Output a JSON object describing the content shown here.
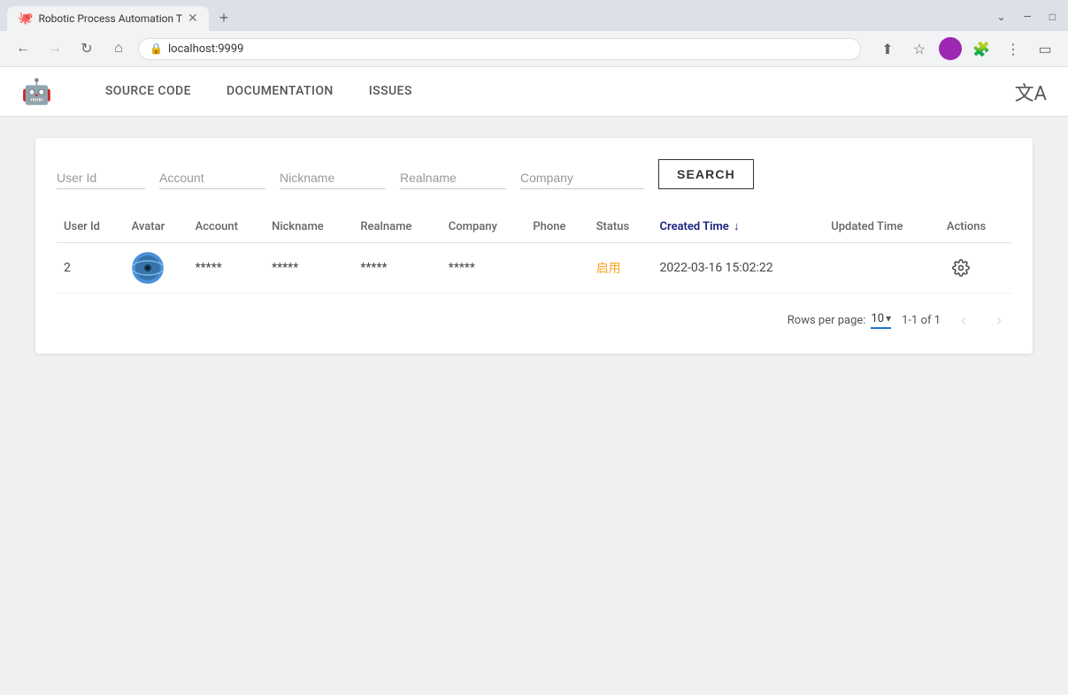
{
  "browser": {
    "tab_title": "Robotic Process Automation T",
    "tab_favicon": "🐙",
    "url": "localhost:9999",
    "new_tab_label": "+",
    "nav_back": "←",
    "nav_forward": "→",
    "nav_refresh": "↻",
    "nav_home": "⌂",
    "window_minimize": "—",
    "window_maximize": "□",
    "window_close": "✕"
  },
  "app": {
    "title": "Robotic Process Automation",
    "logo_icon": "🤖",
    "nav_items": [
      {
        "id": "source-code",
        "label": "SOURCE CODE"
      },
      {
        "id": "documentation",
        "label": "DOCUMENTATION"
      },
      {
        "id": "issues",
        "label": "ISSUES"
      }
    ],
    "translate_icon": "文A"
  },
  "search": {
    "fields": [
      {
        "id": "user-id",
        "placeholder": "User Id",
        "value": ""
      },
      {
        "id": "account",
        "placeholder": "Account",
        "value": ""
      },
      {
        "id": "nickname",
        "placeholder": "Nickname",
        "value": ""
      },
      {
        "id": "realname",
        "placeholder": "Realname",
        "value": ""
      },
      {
        "id": "company",
        "placeholder": "Company",
        "value": ""
      }
    ],
    "button_label": "SEARCH"
  },
  "table": {
    "columns": [
      {
        "id": "user-id",
        "label": "User Id",
        "sortable": false
      },
      {
        "id": "avatar",
        "label": "Avatar",
        "sortable": false
      },
      {
        "id": "account",
        "label": "Account",
        "sortable": false
      },
      {
        "id": "nickname",
        "label": "Nickname",
        "sortable": false
      },
      {
        "id": "realname",
        "label": "Realname",
        "sortable": false
      },
      {
        "id": "company",
        "label": "Company",
        "sortable": false
      },
      {
        "id": "phone",
        "label": "Phone",
        "sortable": false
      },
      {
        "id": "status",
        "label": "Status",
        "sortable": false
      },
      {
        "id": "created-time",
        "label": "Created Time",
        "sortable": true,
        "sort_dir": "desc"
      },
      {
        "id": "updated-time",
        "label": "Updated Time",
        "sortable": false
      },
      {
        "id": "actions",
        "label": "Actions",
        "sortable": false
      }
    ],
    "rows": [
      {
        "user_id": "2",
        "avatar": "🌐",
        "account": "*****",
        "nickname": "*****",
        "realname": "*****",
        "company": "*****",
        "phone": "",
        "status": "启用",
        "created_time": "2022-03-16 15:02:22",
        "updated_time": "",
        "action_icon": "⚙"
      }
    ]
  },
  "pagination": {
    "rows_per_page_label": "Rows per page:",
    "rows_per_page_value": "10",
    "page_info": "1-1 of 1",
    "prev_disabled": true,
    "next_disabled": true
  }
}
